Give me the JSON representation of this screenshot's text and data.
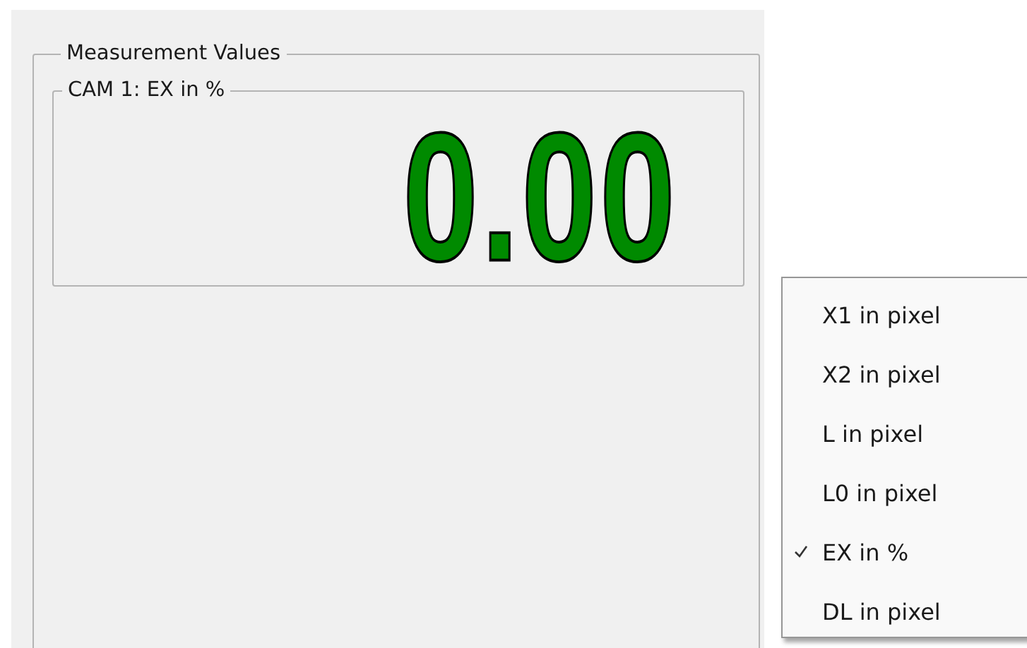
{
  "group": {
    "title": "Measurement Values",
    "panel": {
      "title": "CAM 1: EX in %",
      "value": "0.00"
    }
  },
  "context_menu": {
    "items": [
      {
        "label": "X1 in pixel",
        "checked": false
      },
      {
        "label": "X2 in pixel",
        "checked": false
      },
      {
        "label": "L in pixel",
        "checked": false
      },
      {
        "label": "L0 in pixel",
        "checked": false
      },
      {
        "label": "EX in %",
        "checked": true
      },
      {
        "label": "DL in pixel",
        "checked": false
      }
    ]
  }
}
